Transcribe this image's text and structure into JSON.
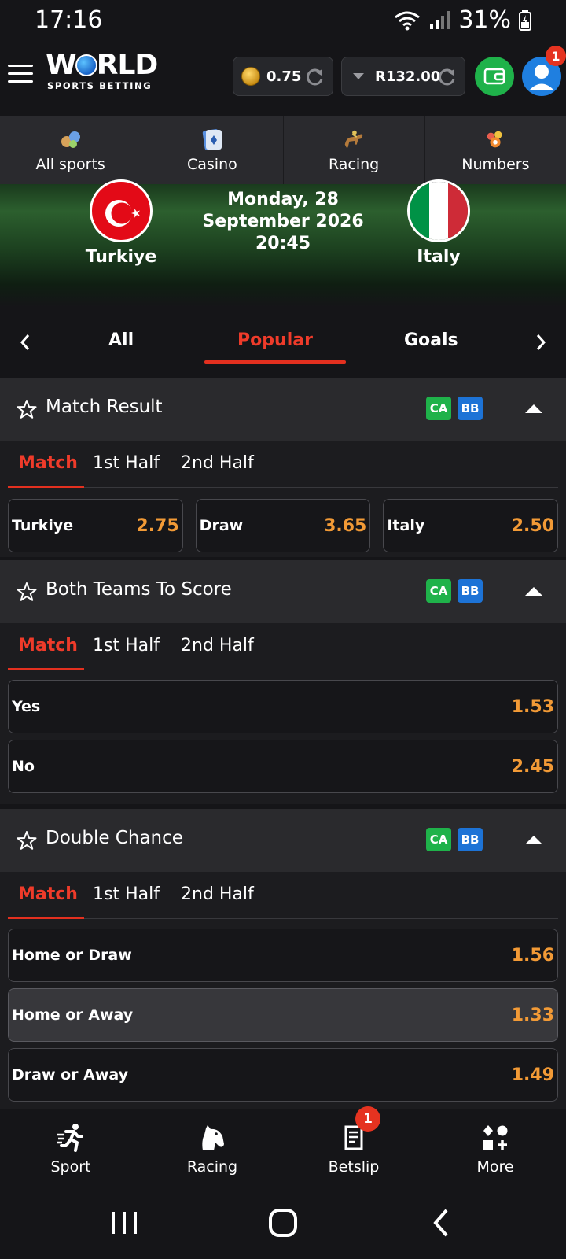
{
  "status_bar": {
    "time": "17:16",
    "battery": "31%"
  },
  "header": {
    "logo_main_1": "W",
    "logo_main_2": "RLD",
    "logo_sub": "SPORTS BETTING",
    "coins": "0.75",
    "balance": "R132.00",
    "profile_badge": "1"
  },
  "sport_nav": [
    {
      "label": "All sports",
      "icon": "all-sports-icon"
    },
    {
      "label": "Casino",
      "icon": "casino-cards-icon"
    },
    {
      "label": "Racing",
      "icon": "horse-racing-icon"
    },
    {
      "label": "Numbers",
      "icon": "lottery-balls-icon"
    }
  ],
  "match": {
    "home_team": "Turkiye",
    "away_team": "Italy",
    "date_line1": "Monday, 28",
    "date_line2": "September 2026",
    "time": "20:45"
  },
  "market_tabs": {
    "all": "All",
    "popular": "Popular",
    "goals": "Goals",
    "active": "Popular"
  },
  "period_tabs": {
    "match": "Match",
    "first_half": "1st Half",
    "second_half": "2nd Half",
    "active": "Match"
  },
  "badges": {
    "ca": "CA",
    "bb": "BB"
  },
  "markets": [
    {
      "title": "Match Result",
      "outcomes": [
        {
          "label": "Turkiye",
          "odds": "2.75"
        },
        {
          "label": "Draw",
          "odds": "3.65"
        },
        {
          "label": "Italy",
          "odds": "2.50"
        }
      ]
    },
    {
      "title": "Both Teams To Score",
      "outcomes": [
        {
          "label": "Yes",
          "odds": "1.53"
        },
        {
          "label": "No",
          "odds": "2.45"
        }
      ]
    },
    {
      "title": "Double Chance",
      "outcomes": [
        {
          "label": "Home or Draw",
          "odds": "1.56"
        },
        {
          "label": "Home or Away",
          "odds": "1.33",
          "selected": true
        },
        {
          "label": "Draw or Away",
          "odds": "1.49"
        }
      ]
    }
  ],
  "bottom_nav": {
    "sport": "Sport",
    "racing": "Racing",
    "betslip": "Betslip",
    "betslip_count": "1",
    "more": "More"
  },
  "colors": {
    "accent_red": "#e3301f",
    "odds_orange": "#f29a36",
    "wallet_green": "#1fb24a",
    "avatar_blue": "#1f7fe0"
  }
}
